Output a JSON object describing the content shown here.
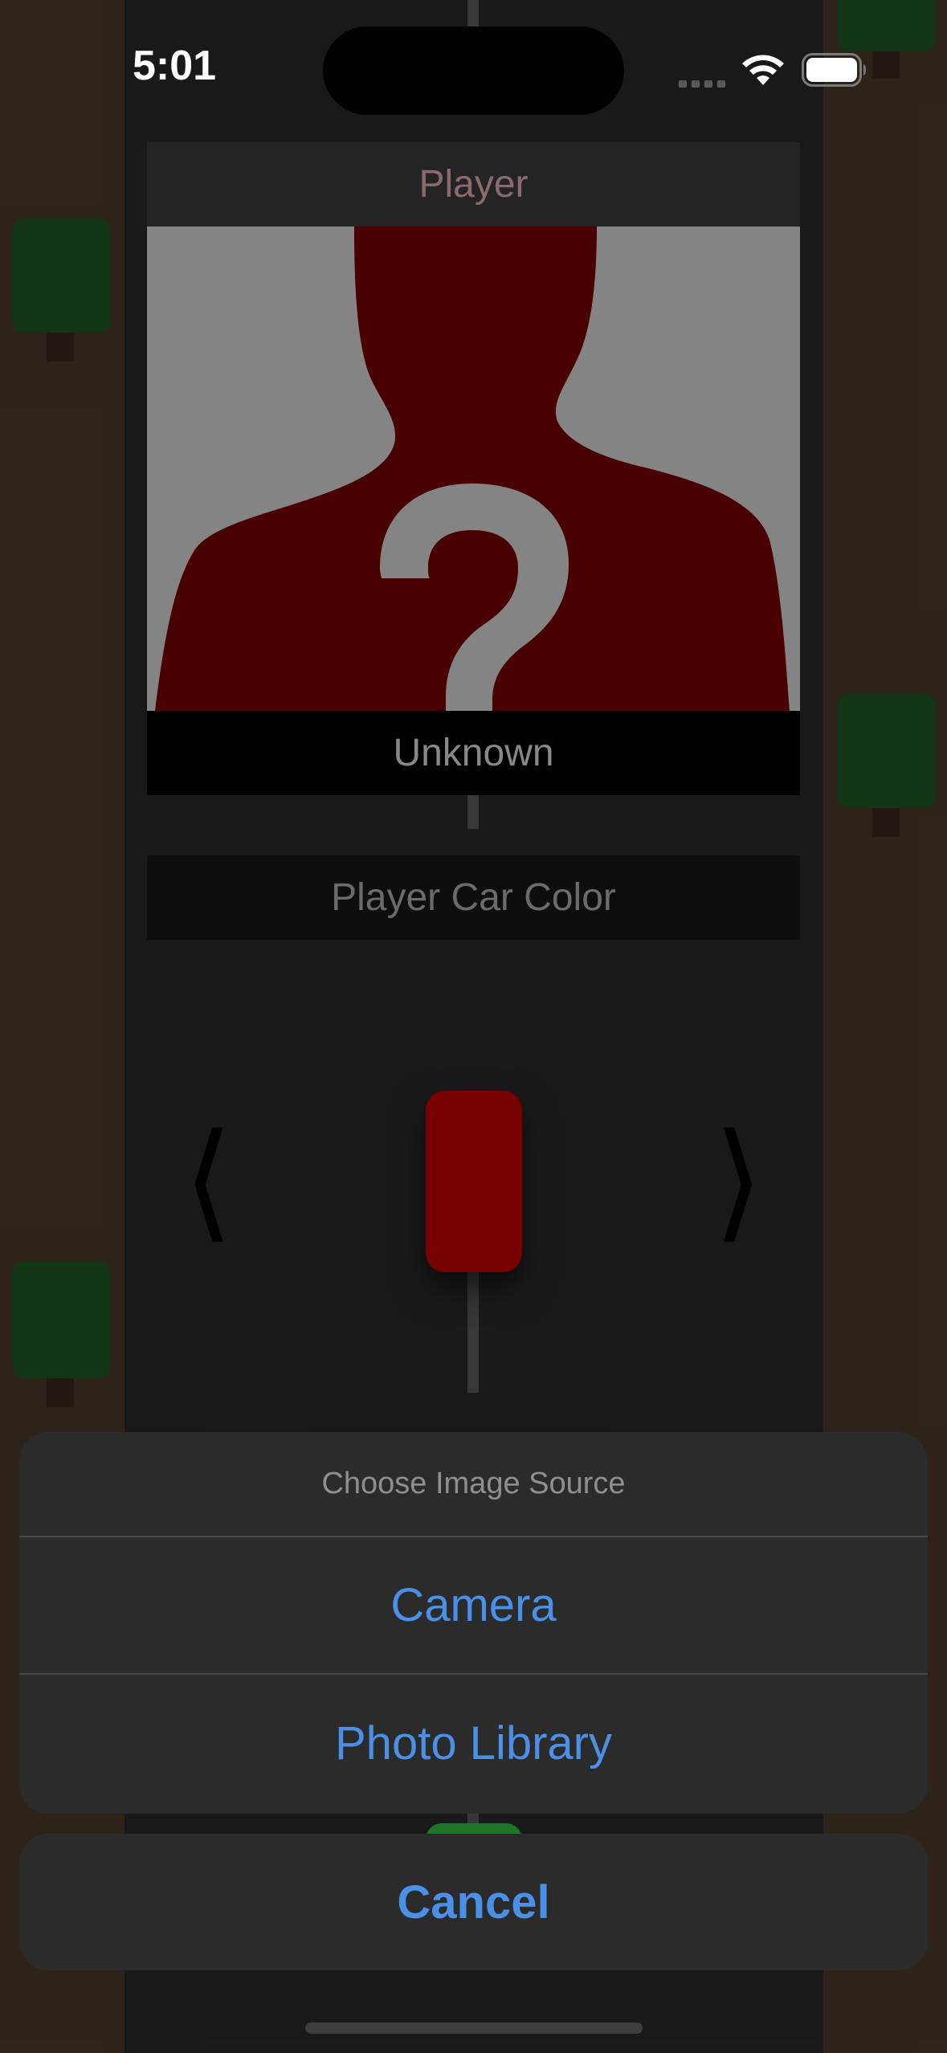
{
  "status_bar": {
    "time": "5:01",
    "icons": [
      "signal-icon",
      "wifi-icon",
      "battery-icon"
    ]
  },
  "player_card": {
    "header": "Player",
    "photo_icon": "unknown-person-question-icon",
    "name": "Unknown"
  },
  "car_selector": {
    "title": "Player Car Color",
    "prev_arrow": "⟨",
    "next_arrow": "⟩",
    "selected_color": "#7c0000"
  },
  "action_sheet": {
    "title": "Choose Image Source",
    "options": [
      "Camera",
      "Photo Library"
    ],
    "cancel": "Cancel"
  },
  "colors": {
    "accent": "#4a90e6",
    "grass": "#302519",
    "road": "#1b1b1d",
    "tree": "#133816"
  }
}
